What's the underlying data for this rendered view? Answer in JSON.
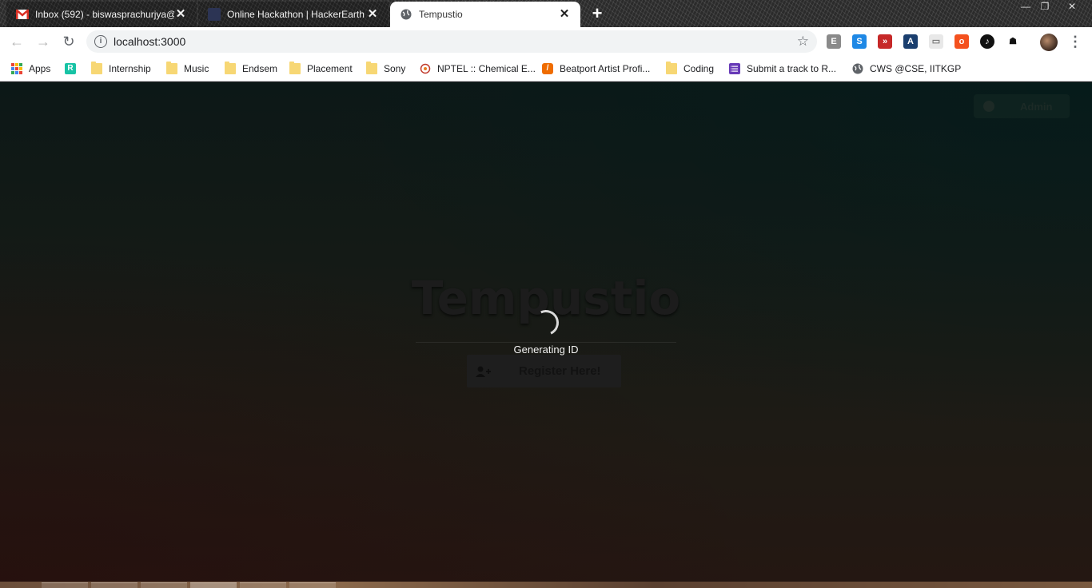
{
  "tabs": [
    {
      "title": "Inbox (592) - biswasprachurjya@",
      "icon": "gmail-icon",
      "active": false
    },
    {
      "title": "Online Hackathon | HackerEarth",
      "icon": "hackerearth-icon",
      "active": false
    },
    {
      "title": "Tempustio",
      "icon": "globe-icon",
      "active": true
    }
  ],
  "toolbar": {
    "url": "localhost:3000"
  },
  "bookmarks": [
    {
      "label": "Apps",
      "icon": "apps-grid-icon"
    },
    {
      "label": "",
      "icon": "r-extension-icon"
    },
    {
      "label": "Internship",
      "icon": "folder-icon"
    },
    {
      "label": "Music",
      "icon": "folder-icon"
    },
    {
      "label": "Endsem",
      "icon": "folder-icon"
    },
    {
      "label": "Placement",
      "icon": "folder-icon"
    },
    {
      "label": "Sony",
      "icon": "folder-icon"
    },
    {
      "label": "NPTEL :: Chemical E...",
      "icon": "nptel-icon"
    },
    {
      "label": "Beatport Artist Profi...",
      "icon": "beatport-icon"
    },
    {
      "label": "Coding",
      "icon": "folder-icon"
    },
    {
      "label": "Submit a track to R...",
      "icon": "form-icon"
    },
    {
      "label": "CWS @CSE, IITKGP",
      "icon": "globe-icon"
    }
  ],
  "page": {
    "admin_label": "Admin",
    "brand": "Tempustio",
    "register_label": "Register Here!",
    "loading_text": "Generating ID"
  },
  "colors": {
    "accent_tab": "#ffffff",
    "page_bg_top": "#0c1817",
    "page_bg_bottom": "#241712",
    "spinner": "#d9d9d9"
  }
}
